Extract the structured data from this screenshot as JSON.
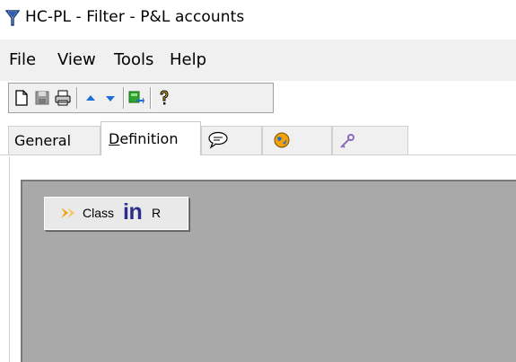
{
  "window": {
    "title": "HC-PL - Filter - P&L accounts",
    "icon": "funnel-icon"
  },
  "menu": {
    "items": [
      "File",
      "View",
      "Tools",
      "Help"
    ]
  },
  "toolbar": {
    "buttons": [
      "new-document-icon",
      "save-icon",
      "print-icon",
      "move-up-icon",
      "move-down-icon",
      "run-filter-icon",
      "help-icon"
    ]
  },
  "tabs": [
    {
      "label": "General",
      "active": false
    },
    {
      "label": "Definition",
      "active": true
    },
    {
      "icon": "comment-icon",
      "active": false
    },
    {
      "icon": "globe-icon",
      "active": false
    },
    {
      "icon": "key-icon",
      "active": false
    }
  ],
  "condition": {
    "field": "Class",
    "operator": "in",
    "value": "R"
  },
  "colors": {
    "canvas": "#a9a9a9",
    "operator": "#2b2f8c",
    "toolbar_arrows": "#1e6fd6"
  }
}
